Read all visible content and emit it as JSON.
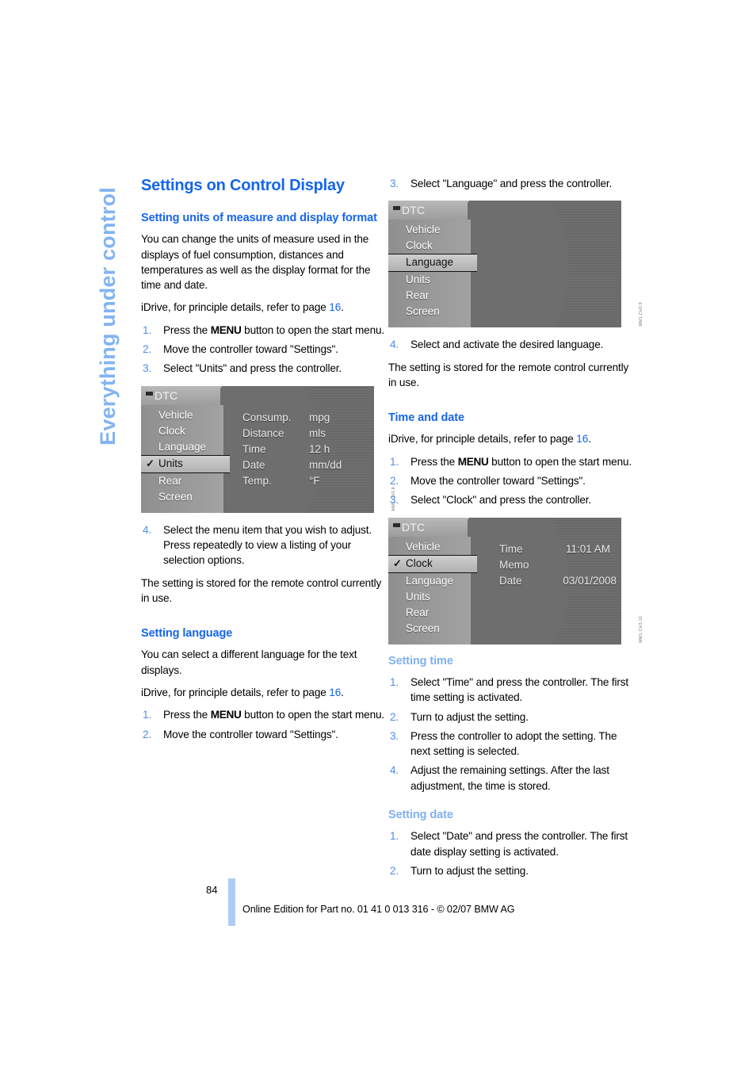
{
  "chapter_tab": {
    "label": "Everything under control"
  },
  "page_title": "Settings on Control Display",
  "left_column": {
    "units_section": {
      "heading": "Setting units of measure and display format",
      "intro": "You can change the units of measure used in the displays of fuel consumption, distances and temperatures as well as the display format for the time and date.",
      "idrive_ref_prefix": "iDrive, for principle details, refer to page ",
      "idrive_ref_page": "16",
      "idrive_ref_suffix": ".",
      "steps_before": [
        {
          "pre": "Press the ",
          "key": "MENU",
          "post": " button to open the start menu."
        },
        {
          "text": "Move the controller toward \"Settings\"."
        },
        {
          "text": "Select \"Units\" and press the controller."
        }
      ],
      "figure": {
        "header_label": "DTC",
        "menu_items": [
          {
            "label": "Vehicle",
            "selected": false,
            "checked": false
          },
          {
            "label": "Clock",
            "selected": false,
            "checked": false
          },
          {
            "label": "Language",
            "selected": false,
            "checked": false
          },
          {
            "label": "Units",
            "selected": true,
            "checked": true
          },
          {
            "label": "Rear",
            "selected": false,
            "checked": false
          },
          {
            "label": "Screen",
            "selected": false,
            "checked": false
          }
        ],
        "values": [
          {
            "key": "Consump.",
            "value": "mpg"
          },
          {
            "key": "Distance",
            "value": "mls"
          },
          {
            "key": "Time",
            "value": "12 h"
          },
          {
            "key": "Date",
            "value": "mm/dd"
          },
          {
            "key": "Temp.",
            "value": "°F"
          }
        ],
        "code": "MM1.CH3.8"
      },
      "step_after": {
        "number": "4.",
        "text": "Select the menu item that you wish to adjust. Press repeatedly to view a listing of your selection options."
      },
      "note": "The setting is stored for the remote control currently in use."
    },
    "language_section": {
      "heading": "Setting language",
      "intro": "You can select a different language for the text displays.",
      "idrive_ref_prefix": "iDrive, for principle details, refer to page ",
      "idrive_ref_page": "16",
      "idrive_ref_suffix": ".",
      "steps": [
        {
          "pre": "Press the ",
          "key": "MENU",
          "post": " button to open the start menu."
        },
        {
          "text": "Move the controller toward \"Settings\"."
        }
      ]
    }
  },
  "right_column": {
    "language_continued": {
      "step3": {
        "number": "3.",
        "text": "Select \"Language\" and press the controller."
      },
      "figure": {
        "header_label": "DTC",
        "menu_items": [
          {
            "label": "Vehicle",
            "selected": false,
            "checked": false
          },
          {
            "label": "Clock",
            "selected": false,
            "checked": false
          },
          {
            "label": "Language",
            "selected": true,
            "checked": false
          },
          {
            "label": "Units",
            "selected": false,
            "checked": false
          },
          {
            "label": "Rear",
            "selected": false,
            "checked": false
          },
          {
            "label": "Screen",
            "selected": false,
            "checked": false
          }
        ],
        "values": [],
        "code": "MM1.CH3.9"
      },
      "step4": {
        "number": "4.",
        "text": "Select and activate the desired language."
      },
      "note": "The setting is stored for the remote control currently in use."
    },
    "time_date_section": {
      "heading": "Time and date",
      "idrive_ref_prefix": "iDrive, for principle details, refer to page ",
      "idrive_ref_page": "16",
      "idrive_ref_suffix": ".",
      "steps": [
        {
          "pre": "Press the ",
          "key": "MENU",
          "post": " button to open the start menu."
        },
        {
          "text": "Move the controller toward \"Settings\"."
        },
        {
          "text": "Select \"Clock\" and press the controller."
        }
      ],
      "figure": {
        "header_label": "DTC",
        "menu_items": [
          {
            "label": "Vehicle",
            "selected": false,
            "checked": false
          },
          {
            "label": "Clock",
            "selected": true,
            "checked": true
          },
          {
            "label": "Language",
            "selected": false,
            "checked": false
          },
          {
            "label": "Units",
            "selected": false,
            "checked": false
          },
          {
            "label": "Rear",
            "selected": false,
            "checked": false
          },
          {
            "label": "Screen",
            "selected": false,
            "checked": false
          }
        ],
        "values": [
          {
            "key": "Time",
            "value": "11:01 AM"
          },
          {
            "key": "Memo",
            "value": ""
          },
          {
            "key": "Date",
            "value": "03/01/2008"
          }
        ],
        "code": "MM1.CH3.10"
      }
    },
    "setting_time_section": {
      "heading": "Setting time",
      "steps": [
        {
          "text": "Select \"Time\" and press the controller. The first time setting is activated."
        },
        {
          "text": "Turn to adjust the setting."
        },
        {
          "text": "Press the controller to adopt the setting. The next setting is selected."
        },
        {
          "text": "Adjust the remaining settings. After the last adjustment, the time is stored."
        }
      ]
    },
    "setting_date_section": {
      "heading": "Setting date",
      "steps": [
        {
          "text": "Select \"Date\" and press the controller. The first date display setting is activated."
        },
        {
          "text": "Turn to adjust the setting."
        }
      ]
    }
  },
  "footer": {
    "page_number": "84",
    "text": "Online Edition for Part no. 01 41 0 013 316 - © 02/07 BMW AG"
  },
  "colors": {
    "heading_blue": "#1565EE",
    "light_blue": "#7FB0F0",
    "tab_blue": "#83B4F0",
    "footer_bar": "#AFCDF4"
  }
}
